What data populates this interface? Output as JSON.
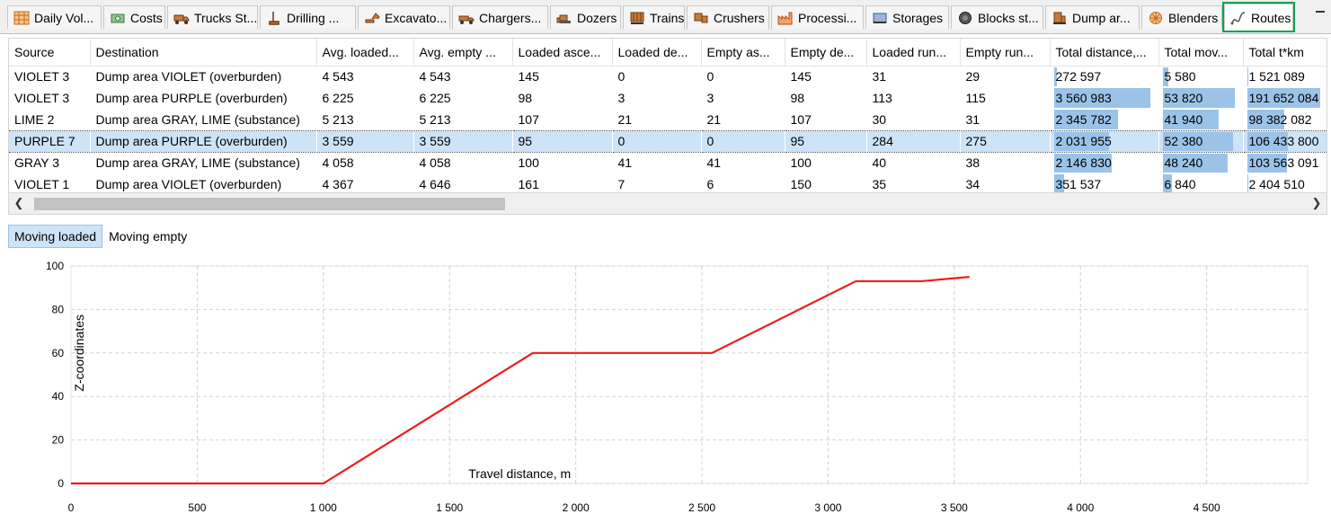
{
  "tabs": [
    {
      "label": "Daily Vol...",
      "icon": "table-grid-icon"
    },
    {
      "label": "Costs",
      "icon": "money-icon"
    },
    {
      "label": "Trucks St...",
      "icon": "truck-icon"
    },
    {
      "label": "Drilling ...",
      "icon": "drill-rig-icon"
    },
    {
      "label": "Excavato...",
      "icon": "excavator-icon"
    },
    {
      "label": "Chargers...",
      "icon": "charger-truck-icon"
    },
    {
      "label": "Dozers",
      "icon": "dozer-icon"
    },
    {
      "label": "Trains",
      "icon": "train-icon"
    },
    {
      "label": "Crushers",
      "icon": "crusher-icon"
    },
    {
      "label": "Processi...",
      "icon": "factory-icon"
    },
    {
      "label": "Storages",
      "icon": "storage-icon"
    },
    {
      "label": "Blocks st...",
      "icon": "block-icon"
    },
    {
      "label": "Dump ar...",
      "icon": "dump-area-icon"
    },
    {
      "label": "Blenders",
      "icon": "blender-icon"
    },
    {
      "label": "Routes",
      "icon": "route-icon",
      "active": true
    }
  ],
  "table": {
    "columns": [
      "Source",
      "Destination",
      "Avg. loaded...",
      "Avg. empty ...",
      "Loaded asce...",
      "Loaded de...",
      "Empty as...",
      "Empty de...",
      "Loaded run...",
      "Empty run...",
      "Total distance,...",
      "Total mov...",
      "Total t*km"
    ],
    "rows": [
      [
        "VIOLET 3",
        "Dump area VIOLET (overburden)",
        "4 543",
        "4 543",
        "145",
        "0",
        "0",
        "145",
        "31",
        "29",
        "272 597",
        "5 580",
        "1 521 089"
      ],
      [
        "VIOLET 3",
        "Dump area PURPLE (overburden)",
        "6 225",
        "6 225",
        "98",
        "3",
        "3",
        "98",
        "113",
        "115",
        "3 560 983",
        "53 820",
        "191 652 084"
      ],
      [
        "LIME 2",
        "Dump area GRAY, LIME (substance)",
        "5 213",
        "5 213",
        "107",
        "21",
        "21",
        "107",
        "30",
        "31",
        "2 345 782",
        "41 940",
        "98 382 082"
      ],
      [
        "PURPLE 7",
        "Dump area PURPLE (overburden)",
        "3 559",
        "3 559",
        "95",
        "0",
        "0",
        "95",
        "284",
        "275",
        "2 031 955",
        "52 380",
        "106 433 800"
      ],
      [
        "GRAY 3",
        "Dump area GRAY, LIME (substance)",
        "4 058",
        "4 058",
        "100",
        "41",
        "41",
        "100",
        "40",
        "38",
        "2 146 830",
        "48 240",
        "103 563 091"
      ],
      [
        "VIOLET 1",
        "Dump area VIOLET (overburden)",
        "4 367",
        "4 646",
        "161",
        "7",
        "6",
        "150",
        "35",
        "34",
        "351 537",
        "6 840",
        "2 404 510"
      ]
    ],
    "selected_row": 3,
    "bar_fractions": {
      "10": [
        0.03,
        1.0,
        0.66,
        0.57,
        0.6,
        0.1
      ],
      "11": [
        0.08,
        1.0,
        0.78,
        0.97,
        0.9,
        0.13
      ],
      "12": [
        0.01,
        1.0,
        0.51,
        0.56,
        0.54,
        0.01
      ]
    }
  },
  "subtabs": [
    {
      "label": "Moving loaded",
      "active": true
    },
    {
      "label": "Moving empty",
      "active": false
    }
  ],
  "chart_data": {
    "type": "line",
    "title": "",
    "xlabel": "Travel distance, m",
    "ylabel": "Z-coordinates",
    "xlim": [
      0,
      4900
    ],
    "ylim": [
      0,
      100
    ],
    "xticks": [
      0,
      500,
      1000,
      1500,
      2000,
      2500,
      3000,
      3500,
      4000,
      4500
    ],
    "xtick_labels": [
      "0",
      "500",
      "1 000",
      "1 500",
      "2 000",
      "2 500",
      "3 000",
      "3 500",
      "4 000",
      "4 500"
    ],
    "yticks": [
      0,
      20,
      40,
      60,
      80,
      100
    ],
    "grid": true,
    "series": [
      {
        "color": "#ee1c1c",
        "x": [
          0,
          1000,
          1830,
          2540,
          3110,
          3370,
          3560
        ],
        "y": [
          0,
          0,
          60,
          60,
          93,
          93,
          95
        ]
      }
    ]
  }
}
